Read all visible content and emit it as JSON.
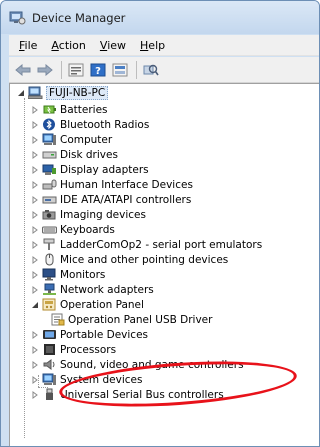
{
  "window": {
    "title": "Device Manager"
  },
  "menu": [
    {
      "accel": "F",
      "rest": "ile"
    },
    {
      "accel": "A",
      "rest": "ction"
    },
    {
      "accel": "V",
      "rest": "iew"
    },
    {
      "accel": "H",
      "rest": "elp"
    }
  ],
  "toolbar": {
    "icons": [
      "back-arrow-icon",
      "forward-arrow-icon",
      "properties-icon",
      "help-icon",
      "update-icon",
      "scan-hardware-icon"
    ]
  },
  "tree": {
    "root": "FUJI-NB-PC",
    "items": [
      {
        "label": "Batteries",
        "icon": "battery-icon",
        "expander": "collapsed"
      },
      {
        "label": "Bluetooth Radios",
        "icon": "bluetooth-icon",
        "expander": "collapsed"
      },
      {
        "label": "Computer",
        "icon": "computer-icon",
        "expander": "collapsed"
      },
      {
        "label": "Disk drives",
        "icon": "disk-drive-icon",
        "expander": "collapsed"
      },
      {
        "label": "Display adapters",
        "icon": "display-adapter-icon",
        "expander": "collapsed"
      },
      {
        "label": "Human Interface Devices",
        "icon": "hid-icon",
        "expander": "collapsed"
      },
      {
        "label": "IDE ATA/ATAPI controllers",
        "icon": "ide-controller-icon",
        "expander": "collapsed"
      },
      {
        "label": "Imaging devices",
        "icon": "camera-icon",
        "expander": "collapsed"
      },
      {
        "label": "Keyboards",
        "icon": "keyboard-icon",
        "expander": "collapsed"
      },
      {
        "label": "LadderComOp2 - serial port emulators",
        "icon": "port-icon",
        "expander": "collapsed"
      },
      {
        "label": "Mice and other pointing devices",
        "icon": "mouse-icon",
        "expander": "collapsed"
      },
      {
        "label": "Monitors",
        "icon": "monitor-icon",
        "expander": "collapsed"
      },
      {
        "label": "Network adapters",
        "icon": "network-adapter-icon",
        "expander": "collapsed"
      },
      {
        "label": "Operation Panel",
        "icon": "operation-panel-icon",
        "expander": "expanded"
      },
      {
        "label": "Operation Panel USB Driver",
        "icon": "usb-driver-icon",
        "expander": "child"
      },
      {
        "label": "Portable Devices",
        "icon": "portable-device-icon",
        "expander": "collapsed"
      },
      {
        "label": "Processors",
        "icon": "processor-icon",
        "expander": "collapsed"
      },
      {
        "label": "Sound, video and game controllers",
        "icon": "sound-icon",
        "expander": "collapsed"
      },
      {
        "label": "System devices",
        "icon": "system-device-icon",
        "expander": "collapsed"
      },
      {
        "label": "Universal Serial Bus controllers",
        "icon": "usb-controller-icon",
        "expander": "collapsed"
      }
    ]
  },
  "colors": {
    "highlight": "#e8121a",
    "selection_bg": "#dde9f7"
  }
}
